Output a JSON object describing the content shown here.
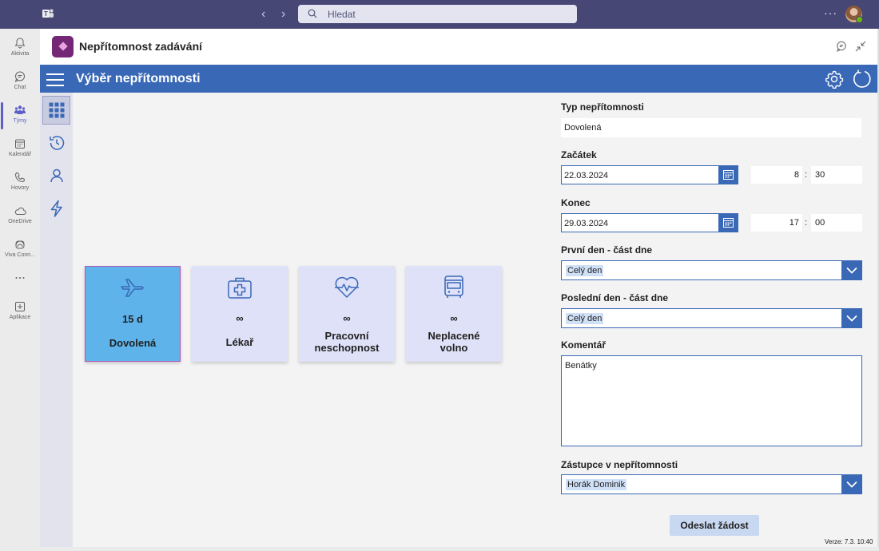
{
  "topbar": {
    "search_placeholder": "Hledat",
    "more": "···",
    "brand_color": "#464775"
  },
  "rail": {
    "items": [
      {
        "label": "Aktivita",
        "icon": "bell-icon"
      },
      {
        "label": "Chat",
        "icon": "chat-icon"
      },
      {
        "label": "Týmy",
        "icon": "teams-icon",
        "active": true
      },
      {
        "label": "Kalendář",
        "icon": "calendar-icon"
      },
      {
        "label": "Hovory",
        "icon": "phone-icon"
      },
      {
        "label": "OneDrive",
        "icon": "cloud-icon"
      },
      {
        "label": "Viva Conn...",
        "icon": "viva-icon"
      },
      {
        "label": "",
        "icon": "more-icon"
      },
      {
        "label": "Aplikace",
        "icon": "add-app-icon"
      }
    ]
  },
  "app": {
    "title": "Nepřítomnost zadávání",
    "page_title": "Výběr nepřítomnosti",
    "accent_color": "#3968b6"
  },
  "tiles": [
    {
      "value": "15 d",
      "name": "Dovolená",
      "icon": "airplane-icon",
      "selected": true
    },
    {
      "value": "∞",
      "name": "Lékař",
      "icon": "medical-kit-icon"
    },
    {
      "value": "∞",
      "name": "Pracovní neschopnost",
      "line1": "Pracovní",
      "line2": "neschopnost",
      "icon": "heart-pulse-icon"
    },
    {
      "value": "∞",
      "name": "Neplacené volno",
      "line1": "Neplacené",
      "line2": "volno",
      "icon": "bus-icon"
    }
  ],
  "form": {
    "type_label": "Typ nepřítomnosti",
    "type_value": "Dovolená",
    "start_label": "Začátek",
    "start_date": "22.03.2024",
    "start_hour": "8",
    "start_minute": "30",
    "end_label": "Konec",
    "end_date": "29.03.2024",
    "end_hour": "17",
    "end_minute": "00",
    "time_sep": ":",
    "first_day_label": "První den - část dne",
    "first_day_value": "Celý den",
    "last_day_label": "Poslední den - část dne",
    "last_day_value": "Celý den",
    "comment_label": "Komentář",
    "comment_value": "Benátky",
    "substitute_label": "Zástupce v nepřítomnosti",
    "substitute_value": "Horák Dominik",
    "submit_label": "Odeslat žádost",
    "version": "Verze: 7.3. 10:40"
  }
}
